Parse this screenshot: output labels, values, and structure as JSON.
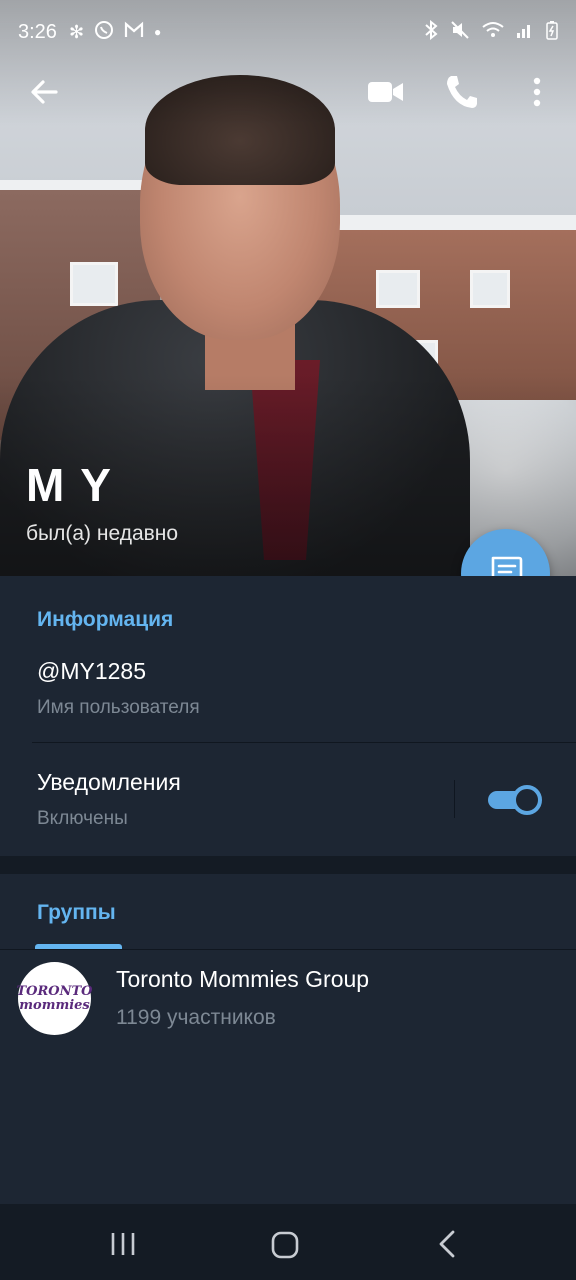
{
  "status_bar": {
    "time": "3:26",
    "left_icons": [
      "fan-icon",
      "whatsapp-icon",
      "gmail-icon",
      "dot-icon"
    ],
    "right_icons": [
      "bluetooth-icon",
      "mute-icon",
      "wifi-icon",
      "signal-icon",
      "battery-charging-icon"
    ]
  },
  "toolbar": {
    "icons": [
      "back-arrow-icon",
      "video-call-icon",
      "phone-icon",
      "more-vert-icon"
    ]
  },
  "profile": {
    "name": "M Y",
    "last_seen": "был(а) недавно"
  },
  "fab": {
    "icon": "message-icon"
  },
  "info": {
    "title": "Информация",
    "username": "@MY1285",
    "username_label": "Имя пользователя",
    "notifications_label": "Уведомления",
    "notifications_state": "Включены",
    "notifications_on": true
  },
  "groups": {
    "tab_label": "Группы",
    "items": [
      {
        "avatar_text": [
          "TORONTO",
          "mommies"
        ],
        "name": "Toronto Mommies Group",
        "members": "1199 участников"
      }
    ]
  },
  "nav_bar": {
    "icons": [
      "recent-apps-icon",
      "home-icon",
      "back-icon"
    ]
  },
  "colors": {
    "background": "#1d2633",
    "accent": "#64b5f0",
    "fab": "#5ca6e2",
    "secondary_text": "#7d8894"
  }
}
